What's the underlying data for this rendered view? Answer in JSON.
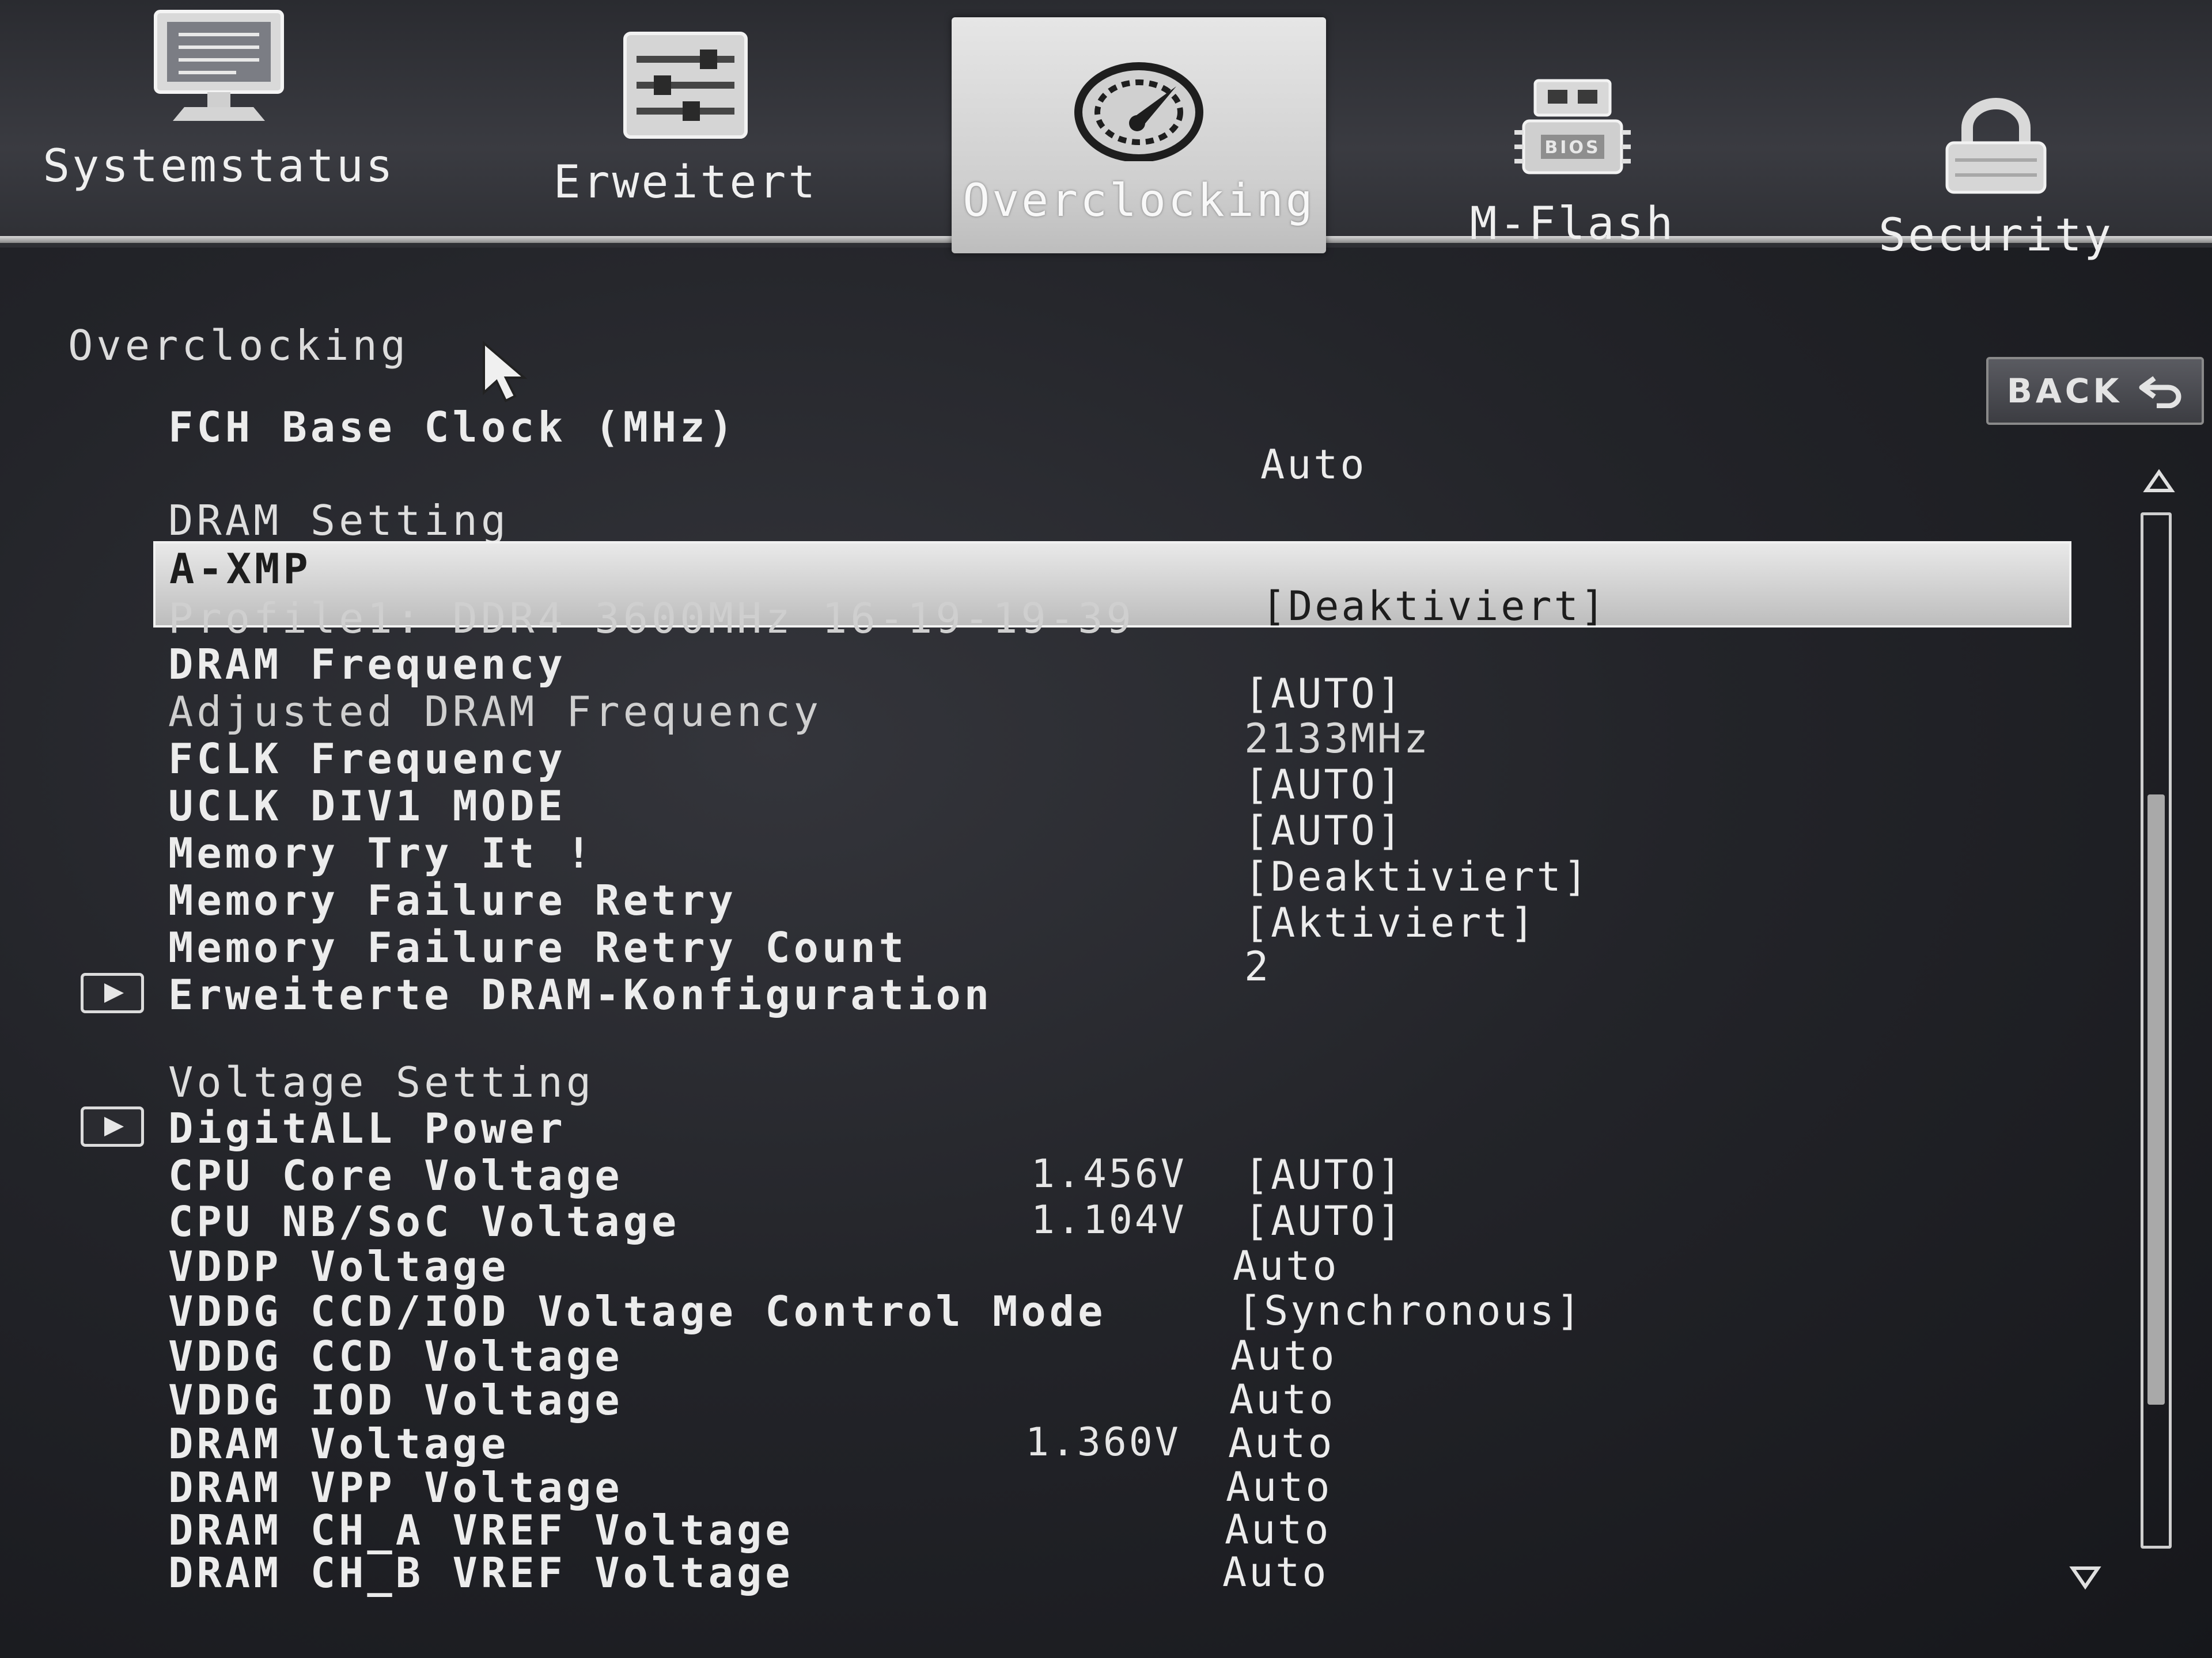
{
  "tabs": [
    {
      "label": "Systemstatus",
      "icon": "monitor-icon",
      "active": false
    },
    {
      "label": "Erweitert",
      "icon": "sliders-icon",
      "active": false
    },
    {
      "label": "Overclocking",
      "icon": "speedometer-icon",
      "active": true
    },
    {
      "label": "M-Flash",
      "icon": "bios-chip-icon",
      "active": false
    },
    {
      "label": "Security",
      "icon": "padlock-icon",
      "active": false
    }
  ],
  "back_button": {
    "label": "BACK",
    "icon": "return-arrow-icon"
  },
  "section_title": "Overclocking",
  "rows": {
    "fch_base_clock": {
      "label": "FCH Base Clock (MHz)",
      "value": "Auto"
    },
    "dram_setting": {
      "label": "DRAM Setting"
    },
    "a_xmp": {
      "label": "A-XMP",
      "value": "[Deaktiviert]"
    },
    "profile1": {
      "label": "Profile1: DDR4 3600MHz 16-19-19-39"
    },
    "dram_frequency": {
      "label": "DRAM Frequency",
      "value": "[AUTO]"
    },
    "adjusted_dram_frequency": {
      "label": "Adjusted DRAM Frequency",
      "value": "2133MHz"
    },
    "fclk_frequency": {
      "label": "FCLK Frequency",
      "value": "[AUTO]"
    },
    "uclk_div1_mode": {
      "label": "UCLK DIV1 MODE",
      "value": "[AUTO]"
    },
    "memory_try_it": {
      "label": "Memory Try It !",
      "value": "[Deaktiviert]"
    },
    "memory_failure_retry": {
      "label": "Memory Failure Retry",
      "value": "[Aktiviert]"
    },
    "memory_failure_retry_count": {
      "label": "Memory Failure Retry Count",
      "value": "2"
    },
    "erweiterte_dram": {
      "label": "Erweiterte DRAM-Konfiguration"
    },
    "voltage_setting": {
      "label": "Voltage Setting"
    },
    "digitall_power": {
      "label": "DigitALL Power"
    },
    "cpu_core_voltage": {
      "label": "CPU Core Voltage",
      "reading": "1.456V",
      "value": "[AUTO]"
    },
    "cpu_nb_soc_voltage": {
      "label": "CPU NB/SoC Voltage",
      "reading": "1.104V",
      "value": "[AUTO]"
    },
    "vddp_voltage": {
      "label": "VDDP Voltage",
      "value": "Auto"
    },
    "vddg_control_mode": {
      "label": "VDDG CCD/IOD Voltage Control Mode",
      "value": "[Synchronous]"
    },
    "vddg_ccd_voltage": {
      "label": "VDDG CCD Voltage",
      "value": "Auto"
    },
    "vddg_iod_voltage": {
      "label": "VDDG IOD Voltage",
      "value": "Auto"
    },
    "dram_voltage": {
      "label": "DRAM Voltage",
      "reading": "1.360V",
      "value": "Auto"
    },
    "dram_vpp_voltage": {
      "label": "DRAM VPP Voltage",
      "value": "Auto"
    },
    "dram_cha_vref_voltage": {
      "label": "DRAM CH_A VREF Voltage",
      "value": "Auto"
    },
    "dram_chb_vref_voltage": {
      "label": "DRAM CH_B VREF Voltage",
      "value": "Auto"
    }
  },
  "scrollbar": {
    "position": 0.3
  }
}
